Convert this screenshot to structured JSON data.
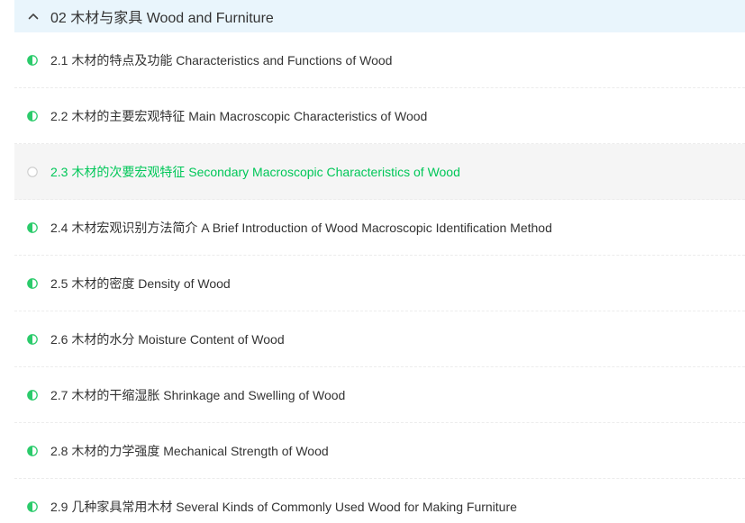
{
  "chapter": {
    "title": "02 木材与家具 Wood and Furniture",
    "expand_icon": "chevron-up-icon"
  },
  "colors": {
    "header_bg": "#e9f5fc",
    "accent": "#00c758",
    "half_icon_green": "#2bcb6b",
    "text": "#333333",
    "active_row_bg": "#f5f5f5"
  },
  "lessons": [
    {
      "label": "2.1 木材的特点及功能 Characteristics and Functions of Wood",
      "status": "half-progress-icon",
      "active": false
    },
    {
      "label": "2.2 木材的主要宏观特征 Main Macroscopic Characteristics of Wood",
      "status": "half-progress-icon",
      "active": false
    },
    {
      "label": "2.3 木材的次要宏观特征 Secondary Macroscopic Characteristics of Wood",
      "status": "empty-circle-icon",
      "active": true
    },
    {
      "label": "2.4 木材宏观识别方法简介 A Brief Introduction of Wood Macroscopic Identification Method",
      "status": "half-progress-icon",
      "active": false
    },
    {
      "label": "2.5 木材的密度 Density of Wood",
      "status": "half-progress-icon",
      "active": false
    },
    {
      "label": "2.6 木材的水分 Moisture Content of Wood",
      "status": "half-progress-icon",
      "active": false
    },
    {
      "label": "2.7 木材的干缩湿胀 Shrinkage and Swelling of Wood",
      "status": "half-progress-icon",
      "active": false
    },
    {
      "label": "2.8 木材的力学强度 Mechanical Strength of Wood",
      "status": "half-progress-icon",
      "active": false
    },
    {
      "label": "2.9 几种家具常用木材 Several Kinds of Commonly Used Wood for Making Furniture",
      "status": "half-progress-icon",
      "active": false
    }
  ]
}
